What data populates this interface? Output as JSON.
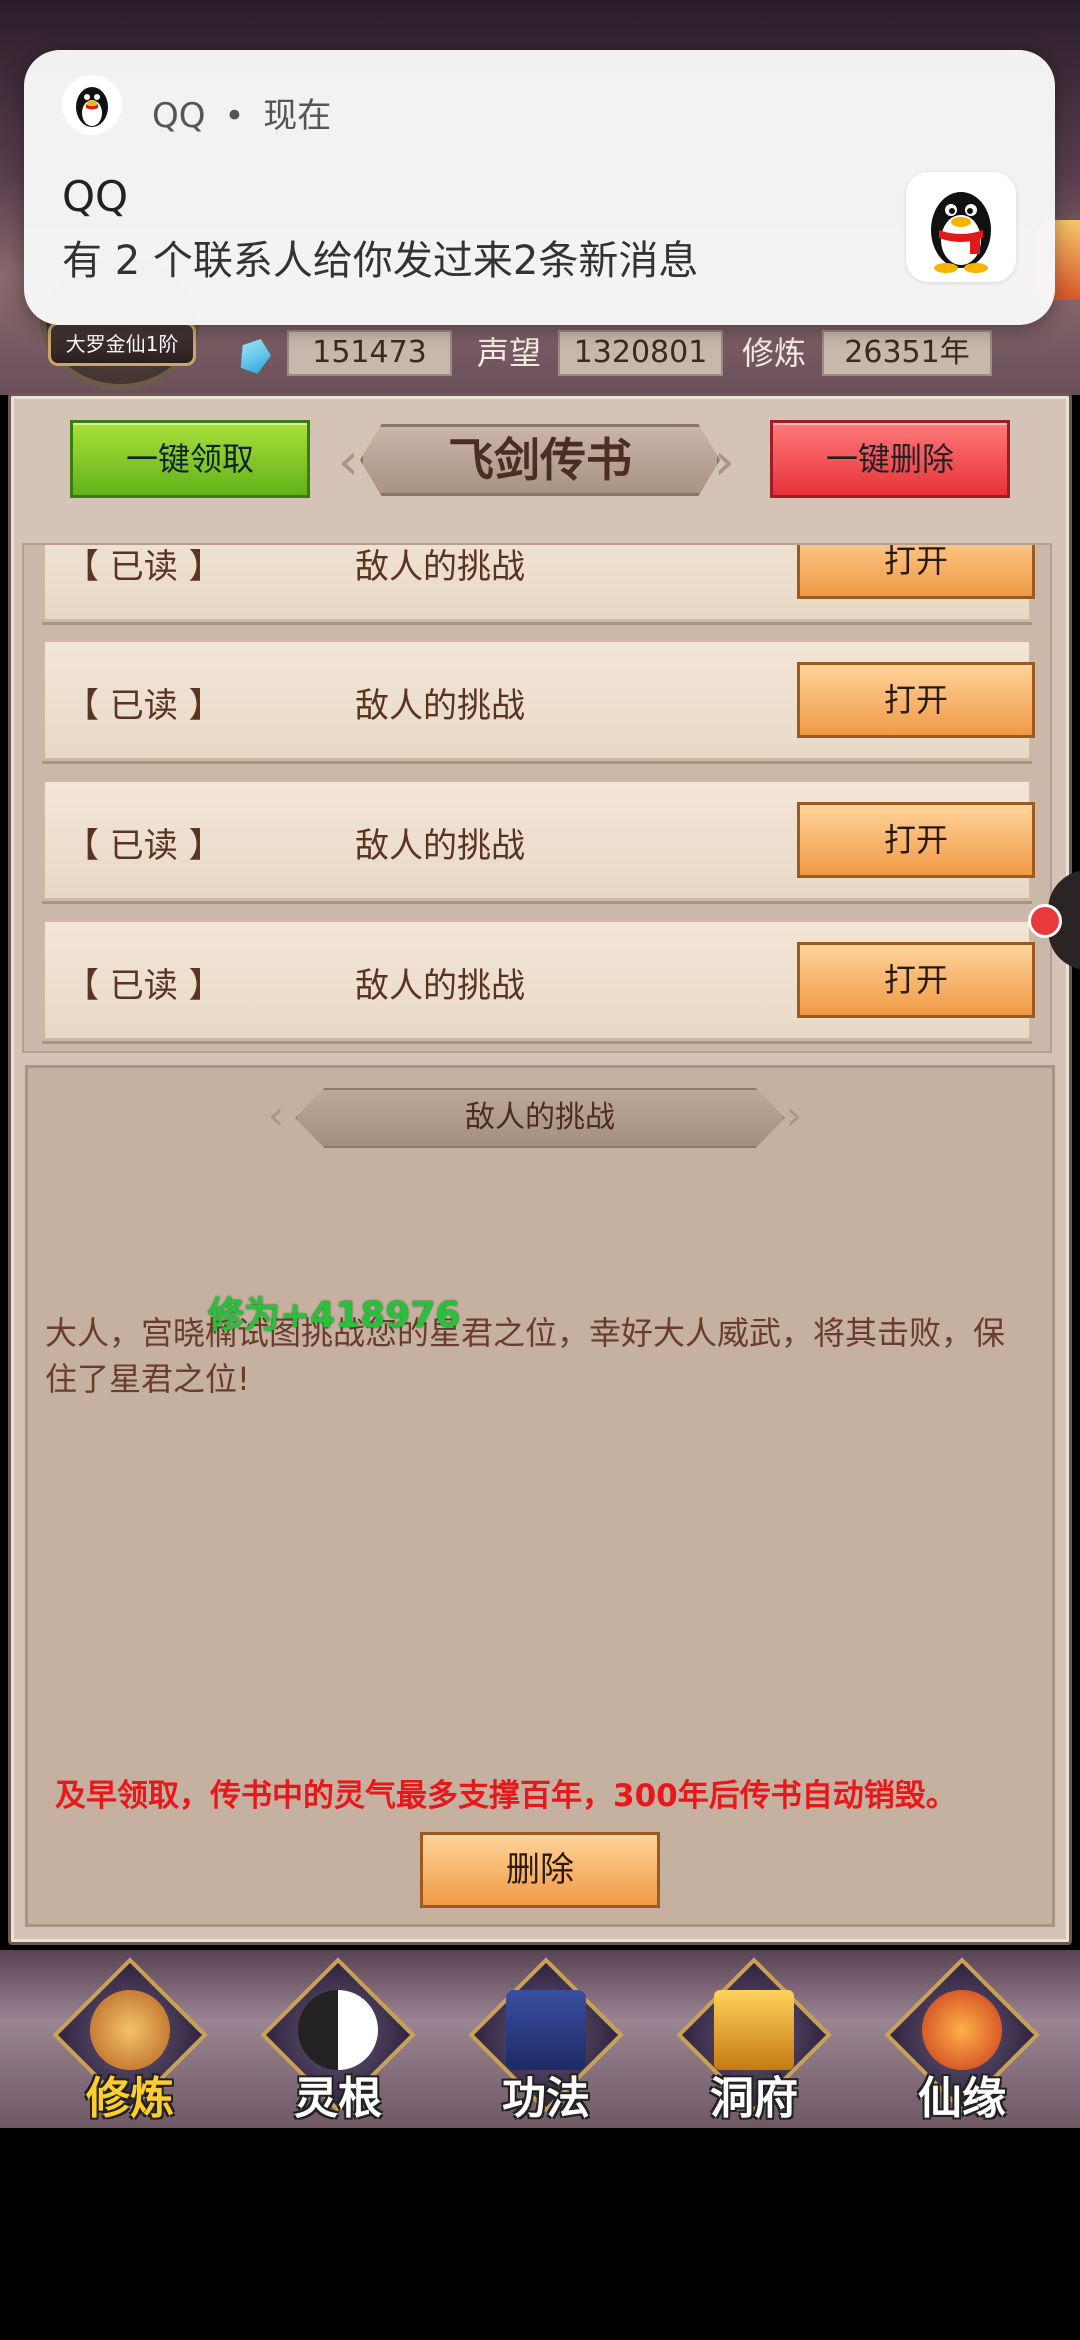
{
  "notification": {
    "app_name": "QQ",
    "separator": "•",
    "time": "现在",
    "title": "QQ",
    "body": "有 2 个联系人给你发过来2条新消息"
  },
  "player": {
    "rank": "大罗金仙1阶",
    "gems": "151473",
    "prestige_label": "声望",
    "prestige": "1320801",
    "cultivation_label": "修炼",
    "cultivation": "26351年"
  },
  "mail_panel": {
    "claim_all_label": "一键领取",
    "title": "飞剑传书",
    "delete_all_label": "一键删除",
    "messages": [
      {
        "status": "【 已读 】",
        "subject": "敌人的挑战",
        "action": "打开"
      },
      {
        "status": "【 已读 】",
        "subject": "敌人的挑战",
        "action": "打开"
      },
      {
        "status": "【 已读 】",
        "subject": "敌人的挑战",
        "action": "打开"
      },
      {
        "status": "【 已读 】",
        "subject": "敌人的挑战",
        "action": "打开"
      }
    ]
  },
  "detail": {
    "title": "敌人的挑战",
    "body": "大人，宫晓楠试图挑战您的星君之位，幸好大人威武，将其击败，保住了星君之位!",
    "reward_popup": "修为+418976",
    "warning": "及早领取，传书中的灵气最多支撑百年，300年后传书自动销毁。",
    "delete_label": "删除"
  },
  "bottom_nav": {
    "items": [
      {
        "label": "修炼",
        "icon": "monk-icon",
        "active": true
      },
      {
        "label": "灵根",
        "icon": "yin-yang-sword-icon",
        "active": false
      },
      {
        "label": "功法",
        "icon": "scripture-book-icon",
        "active": false
      },
      {
        "label": "洞府",
        "icon": "pagoda-icon",
        "active": false
      },
      {
        "label": "仙缘",
        "icon": "gourd-icon",
        "active": false
      }
    ]
  },
  "colors": {
    "claim_button": "#62b21a",
    "delete_all_button": "#e8323a",
    "open_button": "#f09a45",
    "warning_text": "#e8181a",
    "reward_text": "#27c23a"
  }
}
